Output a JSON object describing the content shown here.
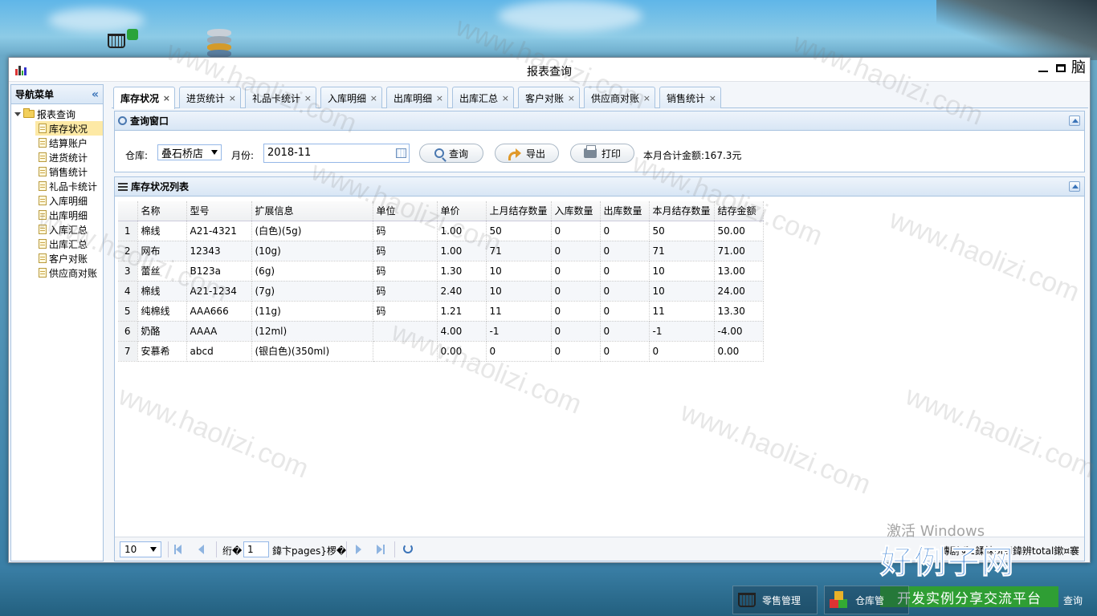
{
  "window": {
    "title": "报表查询",
    "extra_ctrl": "脑"
  },
  "nav": {
    "title": "导航菜单",
    "collapse_icon": "double-chevron-left",
    "root": "报表查询",
    "items": [
      "库存状况",
      "结算账户",
      "进货统计",
      "销售统计",
      "礼品卡统计",
      "入库明细",
      "出库明细",
      "入库汇总",
      "出库汇总",
      "客户对账",
      "供应商对账"
    ],
    "selected": "库存状况"
  },
  "tabs": [
    {
      "label": "库存状况",
      "active": true
    },
    {
      "label": "进货统计"
    },
    {
      "label": "礼品卡统计"
    },
    {
      "label": "入库明细"
    },
    {
      "label": "出库明细"
    },
    {
      "label": "出库汇总"
    },
    {
      "label": "客户对账"
    },
    {
      "label": "供应商对账"
    },
    {
      "label": "销售统计"
    }
  ],
  "tab_close": "×",
  "query": {
    "title": "查询窗口",
    "warehouse_label": "仓库:",
    "warehouse_value": "叠石桥店",
    "month_label": "月份:",
    "month_value": "2018-11",
    "search_btn": "查询",
    "export_btn": "导出",
    "print_btn": "打印",
    "total_text": "本月合计金额:167.3元"
  },
  "grid": {
    "title": "库存状况列表",
    "columns": [
      "名称",
      "型号",
      "扩展信息",
      "单位",
      "单价",
      "上月结存数量",
      "入库数量",
      "出库数量",
      "本月结存数量",
      "结存金额"
    ],
    "rows": [
      [
        "1",
        "棉线",
        "A21-4321",
        "(白色)(5g)",
        "码",
        "1.00",
        "50",
        "0",
        "0",
        "50",
        "50.00"
      ],
      [
        "2",
        "网布",
        "12343",
        "(10g)",
        "码",
        "1.00",
        "71",
        "0",
        "0",
        "71",
        "71.00"
      ],
      [
        "3",
        "蕾丝",
        "B123a",
        "(6g)",
        "码",
        "1.30",
        "10",
        "0",
        "0",
        "10",
        "13.00"
      ],
      [
        "4",
        "棉线",
        "A21-1234",
        "(7g)",
        "码",
        "2.40",
        "10",
        "0",
        "0",
        "10",
        "24.00"
      ],
      [
        "5",
        "纯棉线",
        "AAA666",
        "(11g)",
        "码",
        "1.21",
        "11",
        "0",
        "0",
        "11",
        "13.30"
      ],
      [
        "6",
        "奶酪",
        "AAAA",
        "(12ml)",
        "",
        "4.00",
        "-1",
        "0",
        "0",
        "-1",
        "-4.00"
      ],
      [
        "7",
        "安慕希",
        "abcd",
        "(银白色)(350ml)",
        "",
        "0.00",
        "0",
        "0",
        "0",
        "0",
        "0.00"
      ]
    ]
  },
  "pager": {
    "page_size": "10",
    "before": "绗�",
    "page": "1",
    "after": "鍏卞pages}椤�",
    "info": "鏄剧ず1鍒皌otal鍏辨total鏉¤褰"
  },
  "watermark": "www.haolizi.com",
  "activate": "激活 Windows",
  "brand": {
    "main": "好例子网",
    "sub": "开发实例分享交流平台"
  },
  "taskbar": [
    "零售管理",
    "仓库管",
    "查询"
  ]
}
